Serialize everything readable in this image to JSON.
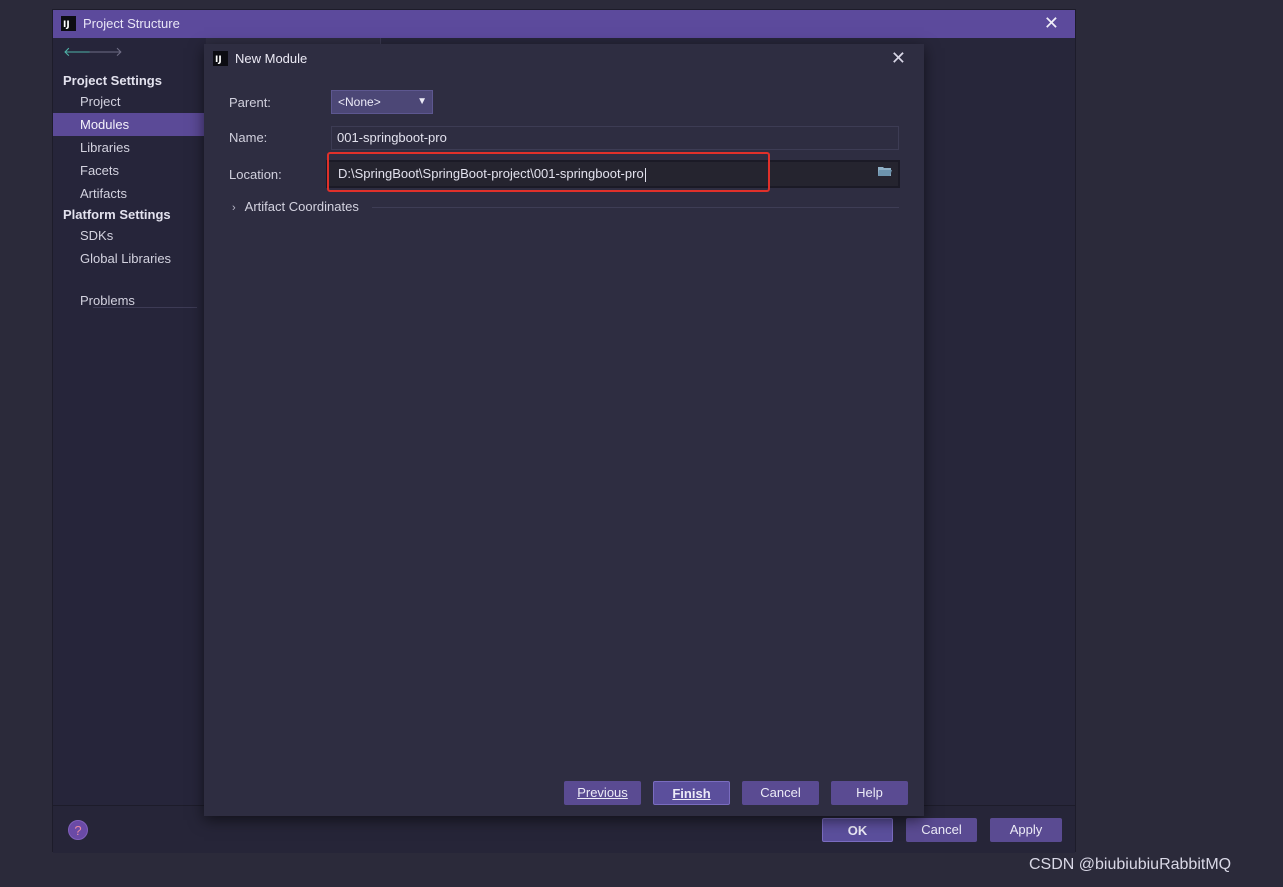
{
  "window": {
    "title": "Project Structure"
  },
  "sidebar": {
    "project_settings_heading": "Project Settings",
    "platform_settings_heading": "Platform Settings",
    "items": [
      {
        "label": "Project"
      },
      {
        "label": "Modules",
        "selected": true
      },
      {
        "label": "Libraries"
      },
      {
        "label": "Facets"
      },
      {
        "label": "Artifacts"
      },
      {
        "label": "SDKs"
      },
      {
        "label": "Global Libraries"
      },
      {
        "label": "Problems"
      }
    ]
  },
  "dialog": {
    "title": "New Module",
    "parent_label": "Parent:",
    "parent_value": "<None>",
    "name_label": "Name:",
    "name_value": "001-springboot-pro",
    "location_label": "Location:",
    "location_value": "D:\\SpringBoot\\SpringBoot-project\\001-springboot-pro",
    "artifact_coordinates": "Artifact Coordinates",
    "buttons": {
      "previous": "Previous",
      "finish": "Finish",
      "cancel": "Cancel",
      "help": "Help"
    }
  },
  "footer": {
    "ok": "OK",
    "cancel": "Cancel",
    "apply": "Apply"
  },
  "watermark": "CSDN @biubiubiuRabbitMQ",
  "colors": {
    "accent": "#5c4a9c",
    "highlight": "#e0302a",
    "background": "#2b2a3a"
  }
}
